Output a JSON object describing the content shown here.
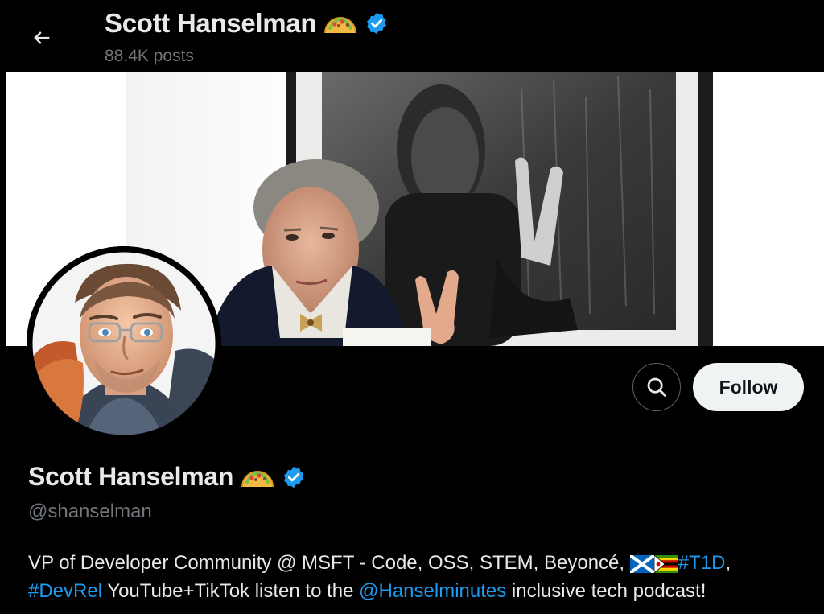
{
  "header": {
    "back_label": "Back",
    "name": "Scott Hanselman",
    "posts_count": "88.4K posts"
  },
  "profile": {
    "name": "Scott Hanselman",
    "handle": "@shanselman",
    "name_emoji": "taco-emoji",
    "verified": true,
    "verified_color": "#1d9bf0"
  },
  "actions": {
    "search_icon": "search-icon",
    "follow_label": "Follow"
  },
  "bio": {
    "text_1": "VP of Developer Community @ MSFT - Code, OSS, STEM, Beyoncé, ",
    "flags": [
      "scotland-flag",
      "zimbabwe-flag"
    ],
    "hashtag_t1d": "#T1D",
    "text_2": ",",
    "hashtag_devrel": "#DevRel",
    "text_3": " YouTube+TikTok listen to the ",
    "mention": "@Hanselminutes",
    "text_4": " inclusive tech podcast!"
  },
  "colors": {
    "background": "#000000",
    "primary_text": "#e7e9ea",
    "secondary_text": "#71767b",
    "link": "#1d9bf0",
    "follow_button_bg": "#eff3f4",
    "follow_button_text": "#0f1419"
  }
}
